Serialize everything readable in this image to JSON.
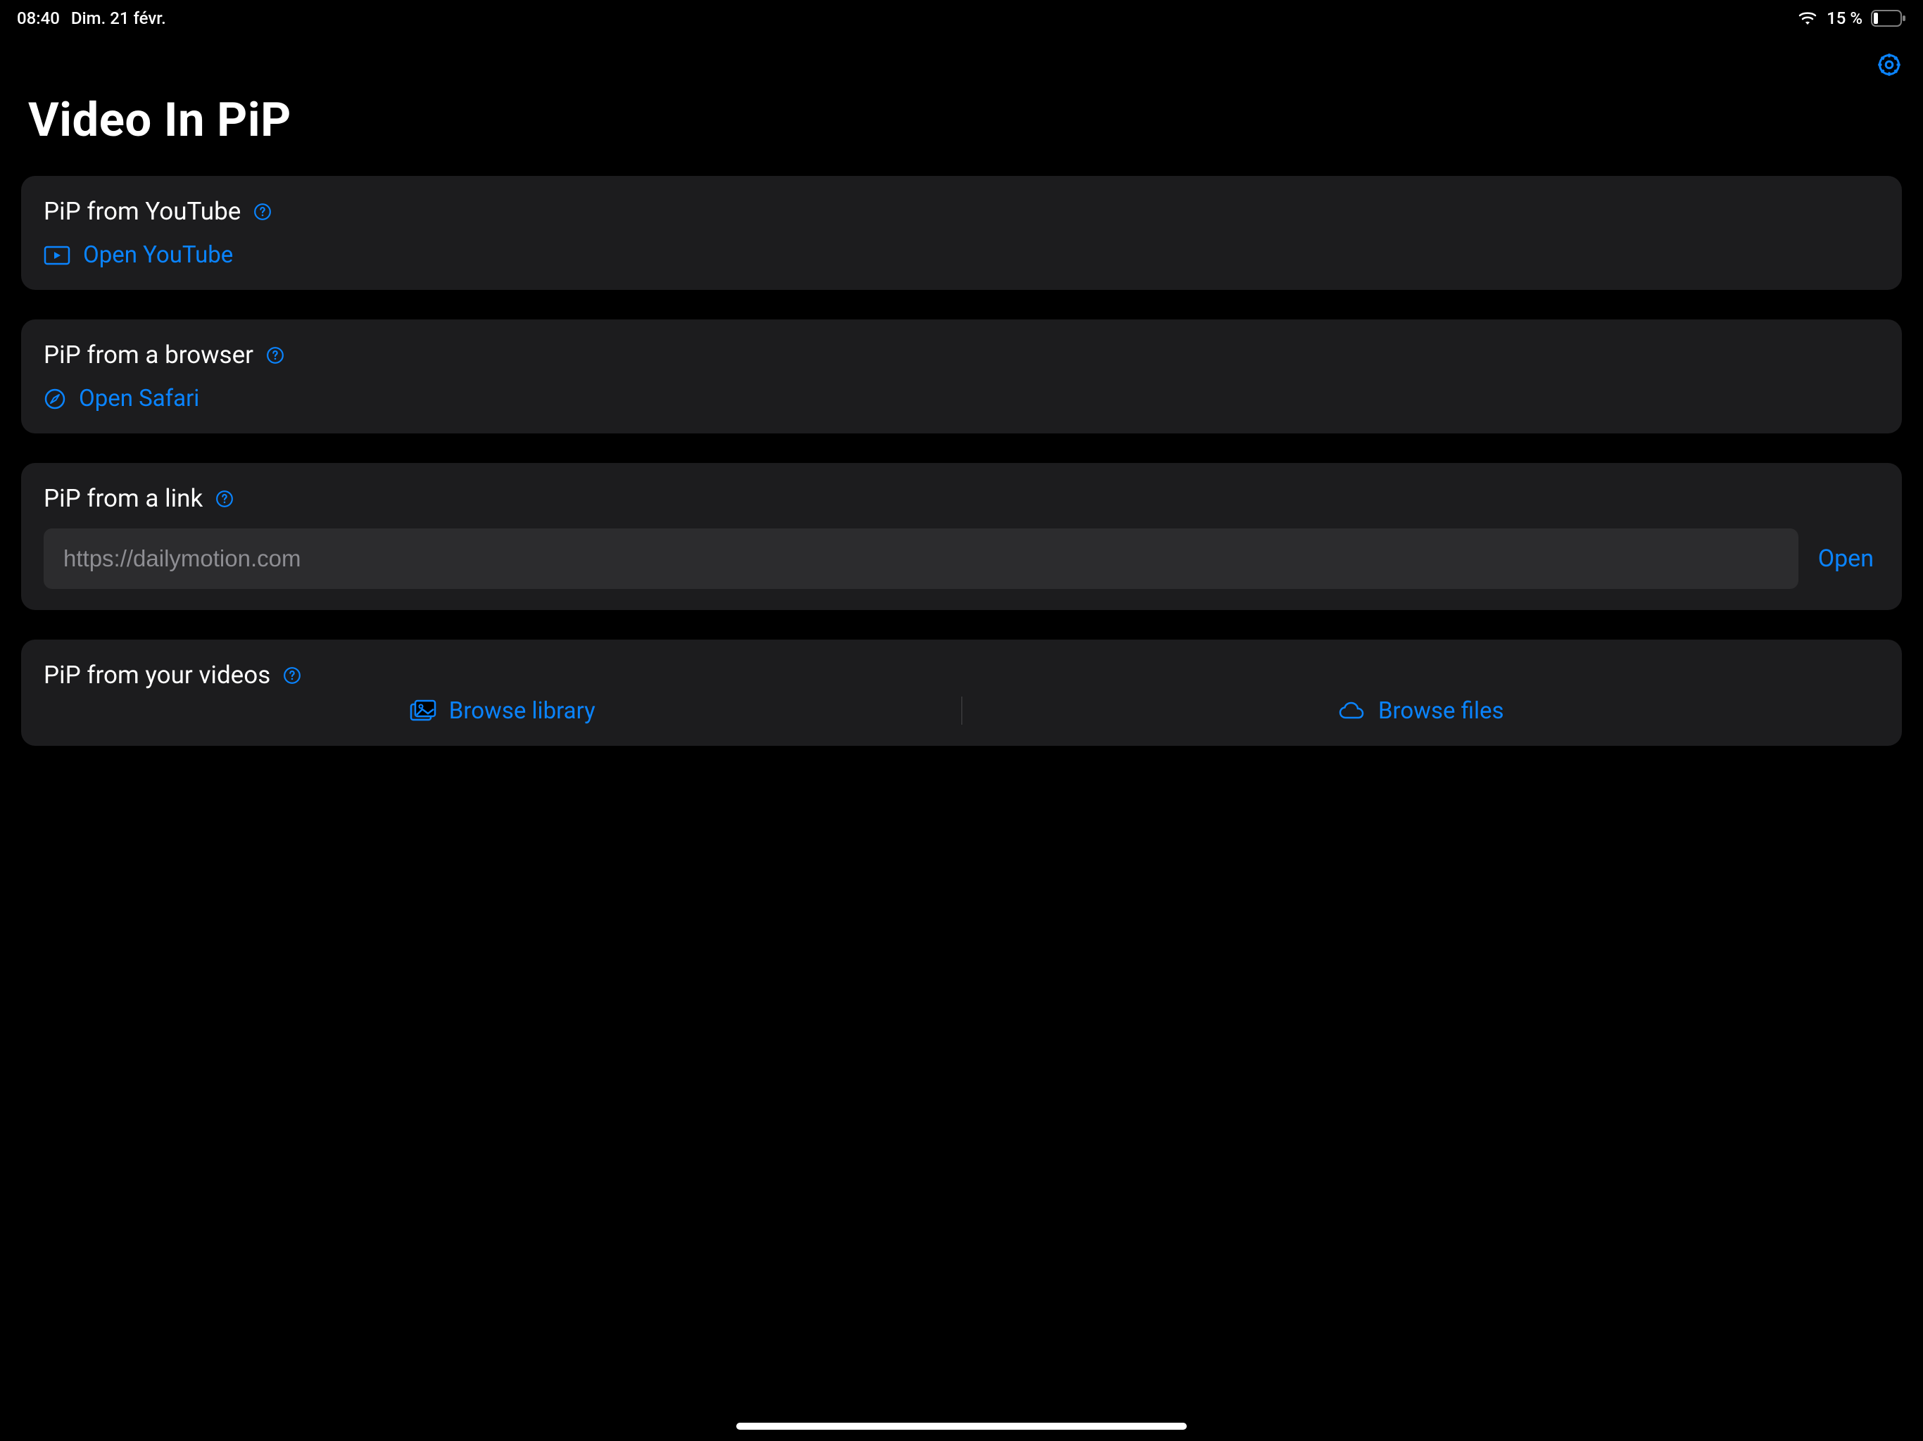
{
  "status": {
    "time": "08:40",
    "date": "Dim. 21 févr.",
    "battery": "15 %"
  },
  "page": {
    "title": "Video In PiP"
  },
  "cards": {
    "youtube": {
      "title": "PiP from YouTube",
      "action": "Open YouTube"
    },
    "browser": {
      "title": "PiP from a browser",
      "action": "Open Safari"
    },
    "link": {
      "title": "PiP from a link",
      "placeholder": "https://dailymotion.com",
      "button": "Open"
    },
    "videos": {
      "title": "PiP from your videos",
      "browse_library": "Browse library",
      "browse_files": "Browse files"
    }
  }
}
